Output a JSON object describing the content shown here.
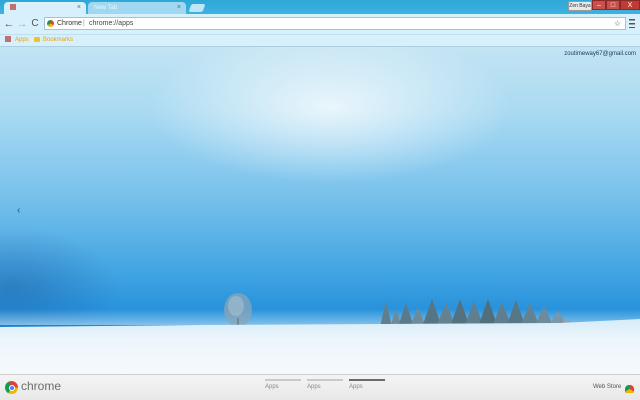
{
  "window": {
    "profile_label": "Zen Baya",
    "minimize_glyph": "–",
    "maximize_glyph": "□",
    "close_glyph": "X"
  },
  "tabs": [
    {
      "label": "Apps",
      "icon": "apps-grid-icon",
      "close_glyph": "×"
    },
    {
      "label": "New Tab",
      "close_glyph": "×"
    }
  ],
  "toolbar": {
    "back_glyph": "←",
    "forward_glyph": "→",
    "reload_glyph": "C",
    "omnibox_chip": "Chrome",
    "omnibox_separator": "|",
    "omnibox_url": "chrome://apps",
    "star_glyph": "☆"
  },
  "bookmarks": {
    "apps_label": "Apps",
    "bookmarks_label": "Bookmarks"
  },
  "page": {
    "account_email": "zoutimeway67@gmail.com",
    "prev_arrow_glyph": "‹"
  },
  "bottom_bar": {
    "wordmark": "chrome",
    "page_switchers": [
      {
        "label": "Apps",
        "selected": false
      },
      {
        "label": "Apps",
        "selected": false
      },
      {
        "label": "Apps",
        "selected": true
      }
    ],
    "web_store_label": "Web Store"
  },
  "colors": {
    "tabstrip": "#2ea7d7",
    "toolbar": "#d8f0fb",
    "sky_top": "#c3e4f3",
    "sky_bottom": "#1d8ad8",
    "snow": "#eef6fb",
    "close_button": "#c13a33"
  }
}
